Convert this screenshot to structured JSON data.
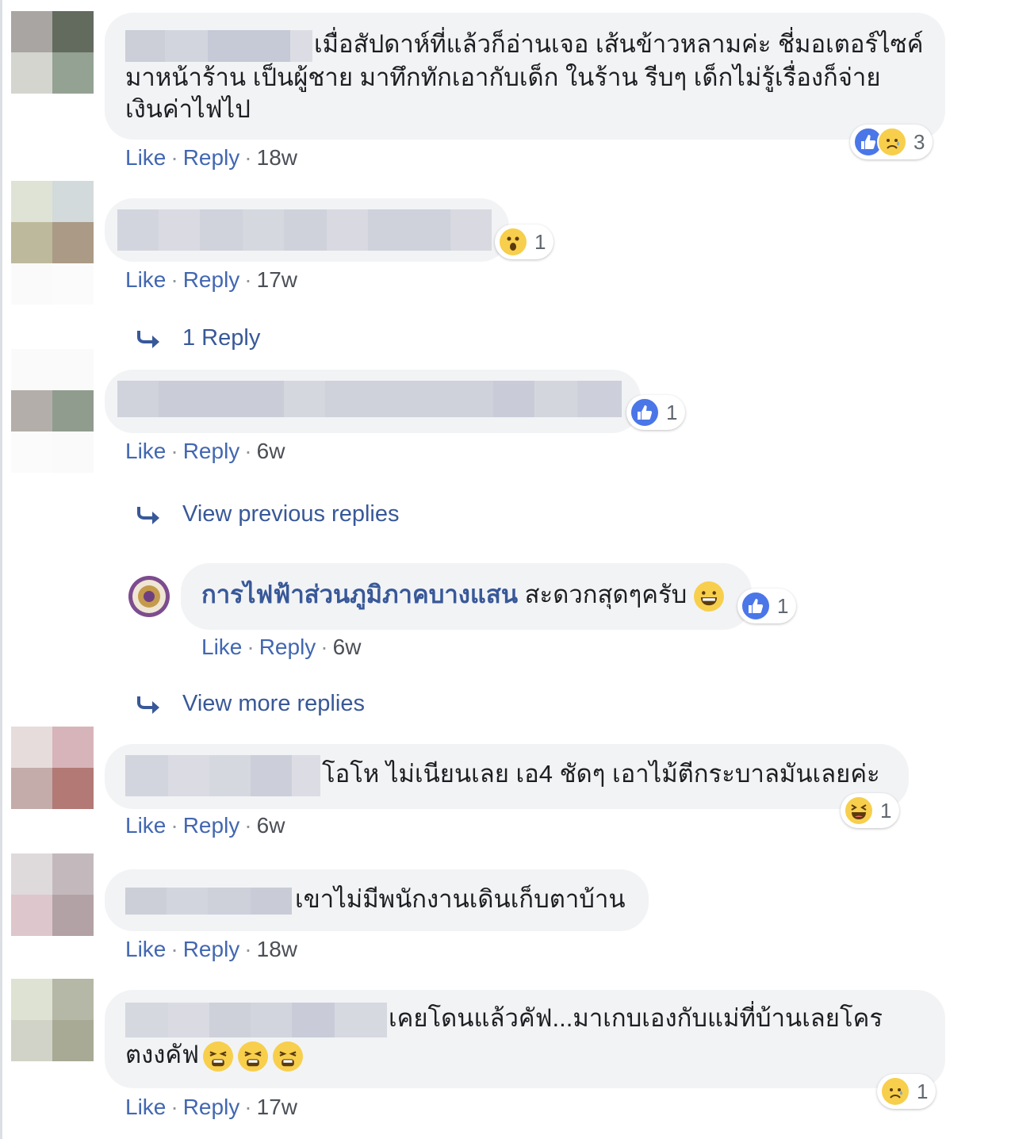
{
  "actions": {
    "like": "Like",
    "reply": "Reply"
  },
  "comments": [
    {
      "text": "เมื่อสัปดาห์ที่แล้วก็อ่านเจอ เส้นข้าวหลามค่ะ ชี่มอเตอร์ไซค์ มาหน้าร้าน เป็นผู้ชาย มาทึกทักเอากับเด็ก ในร้าน รีบๆ เด็กไม่รู้เรื่องก็จ่าย เงินค่าไฟไป",
      "line1": "เมื่อสัปดาห์ที่แล้วก็อ่านเจอ เส้นข้าวหลามค่ะ ชี่มอเตอร์ไซค์",
      "line2": "มาหน้าร้าน เป็นผู้ชาย มาทึกทักเอากับเด็ก ในร้าน รีบๆ เด็กไม่รู้เรื่องก็จ่าย",
      "line3": "เงินค่าไฟไป",
      "time": "18w",
      "reactions": [
        "like-icon",
        "sad-icon"
      ],
      "reaction_count": "3"
    },
    {
      "text": "",
      "time": "17w",
      "reactions": [
        "wow-icon"
      ],
      "reaction_count": "1",
      "replies_label": "1 Reply"
    },
    {
      "text": "",
      "time": "6w",
      "reactions": [
        "like-icon"
      ],
      "reaction_count": "1",
      "view_previous": "View previous replies",
      "reply": {
        "author": "การไฟฟ้าส่วนภูมิภาคบางแสน",
        "text": "สะดวกสุดๆครับ",
        "time": "6w",
        "reactions": [
          "like-icon"
        ],
        "reaction_count": "1"
      },
      "view_more": "View more replies"
    },
    {
      "text": "โอโห ไม่เนียนเลย เอ4 ชัดๆ เอาไม้ตีกระบาลมันเลยค่ะ",
      "time": "6w",
      "reactions": [
        "haha-icon"
      ],
      "reaction_count": "1"
    },
    {
      "text": "เขาไม่มีพนักงานเดินเก็บตาบ้าน",
      "time": "18w"
    },
    {
      "text": "เคยโดนแล้วคัฟ...มาเกบเองกับแม่ที่บ้านเลยโคร ตงงคัฟ",
      "line1": "เคยโดนแล้วคัฟ...มาเกบเองกับแม่ที่บ้านเลยโคร",
      "line2": "ตงงคัฟ",
      "time": "17w",
      "reactions": [
        "sad-icon"
      ],
      "reaction_count": "1"
    }
  ],
  "colors": {
    "link": "#4267b2",
    "bubble": "#f2f3f5",
    "like": "#4a76e8",
    "emoji": "#f7cf4c"
  }
}
